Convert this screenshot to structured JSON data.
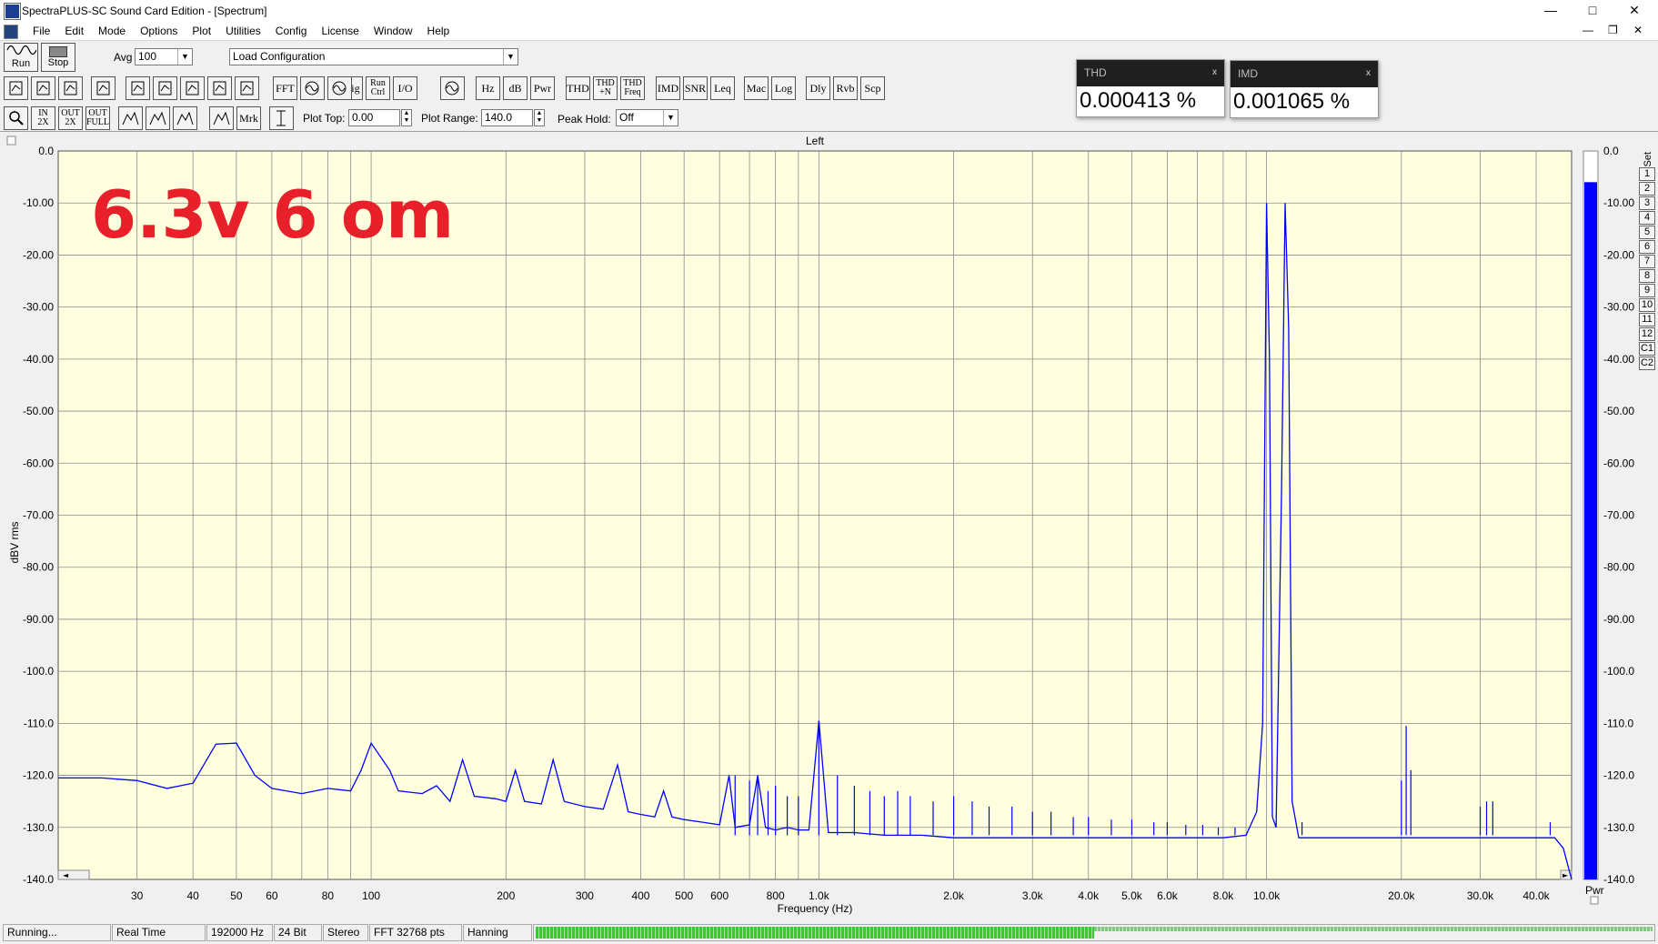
{
  "window": {
    "title": "SpectraPLUS-SC Sound Card Edition - [Spectrum]"
  },
  "menu": [
    "File",
    "Edit",
    "Mode",
    "Options",
    "Plot",
    "Utilities",
    "Config",
    "License",
    "Window",
    "Help"
  ],
  "toolbar": {
    "run_label": "Run",
    "stop_label": "Stop",
    "avg_label": "Avg",
    "avg_value": "100",
    "config_value": "Load Configuration",
    "buttons": [
      "FFT",
      "Trig",
      "Run Ctrl",
      "I/O",
      "Hz",
      "dB",
      "Pwr",
      "THD",
      "THD +N",
      "THD Freq",
      "IMD",
      "SNR",
      "Leq",
      "Mac",
      "Log",
      "Dly",
      "Rvb",
      "Scp"
    ],
    "zoom_buttons": [
      "IN 2X",
      "OUT 2X",
      "OUT FULL"
    ],
    "mrk_label": "Mrk",
    "plot_top_label": "Plot Top:",
    "plot_top_value": "0.00",
    "plot_range_label": "Plot Range:",
    "plot_range_value": "140.0",
    "peak_hold_label": "Peak Hold:",
    "peak_hold_value": "Off"
  },
  "meters": [
    {
      "title": "THD",
      "close": "x",
      "value": "0.000413 %"
    },
    {
      "title": "IMD",
      "close": "x",
      "value": "0.001065 %"
    }
  ],
  "annotation": "6.3v 6 om",
  "set_panel": {
    "label": "Set",
    "items": [
      "1",
      "2",
      "3",
      "4",
      "5",
      "6",
      "7",
      "8",
      "9",
      "10",
      "11",
      "12",
      "C1",
      "C2"
    ]
  },
  "colors": {
    "plot_background": "#ffffe0",
    "trace": "#0000ff",
    "grid": "#8a8a8a",
    "annotation": "#e8202a",
    "level_bar": "#0000ff",
    "status_meter": "#33cc33"
  },
  "chart_data": {
    "type": "line",
    "title": "Left",
    "xlabel": "Frequency (Hz)",
    "ylabel": "dBV rms",
    "x_scale": "log",
    "xlim": [
      20,
      48000
    ],
    "ylim": [
      -140,
      0
    ],
    "grid": true,
    "x_ticks": [
      {
        "v": 30,
        "label": "30"
      },
      {
        "v": 40,
        "label": "40"
      },
      {
        "v": 50,
        "label": "50"
      },
      {
        "v": 60,
        "label": "60"
      },
      {
        "v": 80,
        "label": "80"
      },
      {
        "v": 100,
        "label": "100"
      },
      {
        "v": 200,
        "label": "200"
      },
      {
        "v": 300,
        "label": "300"
      },
      {
        "v": 400,
        "label": "400"
      },
      {
        "v": 500,
        "label": "500"
      },
      {
        "v": 600,
        "label": "600"
      },
      {
        "v": 800,
        "label": "800"
      },
      {
        "v": 1000,
        "label": "1.0k"
      },
      {
        "v": 2000,
        "label": "2.0k"
      },
      {
        "v": 3000,
        "label": "3.0k"
      },
      {
        "v": 4000,
        "label": "4.0k"
      },
      {
        "v": 5000,
        "label": "5.0k"
      },
      {
        "v": 6000,
        "label": "6.0k"
      },
      {
        "v": 8000,
        "label": "8.0k"
      },
      {
        "v": 10000,
        "label": "10.0k"
      },
      {
        "v": 20000,
        "label": "20.0k"
      },
      {
        "v": 30000,
        "label": "30.0k"
      },
      {
        "v": 40000,
        "label": "40.0k"
      }
    ],
    "x_minor": [
      70,
      90,
      700,
      900,
      7000,
      9000
    ],
    "y_ticks": [
      {
        "v": 0,
        "label": "0.0"
      },
      {
        "v": -10,
        "label": "-10.00"
      },
      {
        "v": -20,
        "label": "-20.00"
      },
      {
        "v": -30,
        "label": "-30.00"
      },
      {
        "v": -40,
        "label": "-40.00"
      },
      {
        "v": -50,
        "label": "-50.00"
      },
      {
        "v": -60,
        "label": "-60.00"
      },
      {
        "v": -70,
        "label": "-70.00"
      },
      {
        "v": -80,
        "label": "-80.00"
      },
      {
        "v": -90,
        "label": "-90.00"
      },
      {
        "v": -100,
        "label": "-100.0"
      },
      {
        "v": -110,
        "label": "-110.0"
      },
      {
        "v": -120,
        "label": "-120.0"
      },
      {
        "v": -130,
        "label": "-130.0"
      },
      {
        "v": -140,
        "label": "-140.0"
      }
    ],
    "series": [
      {
        "points": [
          [
            20,
            -120.5
          ],
          [
            25,
            -120.5
          ],
          [
            30,
            -121
          ],
          [
            35,
            -122.5
          ],
          [
            40,
            -121.5
          ],
          [
            45,
            -114
          ],
          [
            50,
            -113.8
          ],
          [
            55,
            -120
          ],
          [
            60,
            -122.5
          ],
          [
            70,
            -123.5
          ],
          [
            80,
            -122.5
          ],
          [
            90,
            -123
          ],
          [
            95,
            -119
          ],
          [
            100,
            -113.8
          ],
          [
            110,
            -119
          ],
          [
            115,
            -123
          ],
          [
            130,
            -123.5
          ],
          [
            140,
            -122
          ],
          [
            150,
            -125
          ],
          [
            160,
            -117
          ],
          [
            170,
            -124
          ],
          [
            190,
            -124.5
          ],
          [
            200,
            -125
          ],
          [
            210,
            -119
          ],
          [
            220,
            -125
          ],
          [
            240,
            -125.5
          ],
          [
            255,
            -117
          ],
          [
            270,
            -125
          ],
          [
            300,
            -126
          ],
          [
            330,
            -126.5
          ],
          [
            355,
            -118
          ],
          [
            375,
            -127
          ],
          [
            400,
            -127.5
          ],
          [
            430,
            -128
          ],
          [
            450,
            -123
          ],
          [
            470,
            -128
          ],
          [
            500,
            -128.5
          ],
          [
            550,
            -129
          ],
          [
            600,
            -129.5
          ],
          [
            630,
            -120
          ],
          [
            650,
            -130
          ],
          [
            700,
            -129.5
          ],
          [
            730,
            -120
          ],
          [
            760,
            -130
          ],
          [
            800,
            -130.5
          ],
          [
            850,
            -130
          ],
          [
            900,
            -130.5
          ],
          [
            950,
            -130.5
          ],
          [
            1000,
            -109.5
          ],
          [
            1050,
            -131
          ],
          [
            1100,
            -131
          ],
          [
            1200,
            -131
          ],
          [
            1400,
            -131.5
          ],
          [
            1700,
            -131.5
          ],
          [
            2000,
            -132
          ],
          [
            2500,
            -132
          ],
          [
            3000,
            -132
          ],
          [
            4000,
            -132
          ],
          [
            5000,
            -132
          ],
          [
            6000,
            -132
          ],
          [
            7000,
            -132
          ],
          [
            8000,
            -132
          ],
          [
            9000,
            -131.5
          ],
          [
            9500,
            -127
          ],
          [
            9800,
            -110
          ],
          [
            10000,
            -10
          ],
          [
            10150,
            -40
          ],
          [
            10300,
            -128
          ],
          [
            10500,
            -130
          ],
          [
            10800,
            -65
          ],
          [
            11000,
            -10
          ],
          [
            11200,
            -34
          ],
          [
            11400,
            -125
          ],
          [
            11800,
            -132
          ],
          [
            13000,
            -132
          ],
          [
            16000,
            -132
          ],
          [
            19000,
            -132
          ],
          [
            20000,
            -132
          ],
          [
            21000,
            -132
          ],
          [
            25000,
            -132
          ],
          [
            30000,
            -132
          ],
          [
            35000,
            -132
          ],
          [
            40000,
            -132
          ],
          [
            44000,
            -132
          ],
          [
            46000,
            -134
          ],
          [
            48000,
            -140
          ]
        ]
      }
    ],
    "spurs": [
      [
        650,
        -120
      ],
      [
        700,
        -121
      ],
      [
        730,
        -120
      ],
      [
        770,
        -123
      ],
      [
        800,
        -122
      ],
      [
        850,
        -124
      ],
      [
        900,
        -124
      ],
      [
        1000,
        -109.5
      ],
      [
        1100,
        -120
      ],
      [
        1200,
        -122
      ],
      [
        1300,
        -123
      ],
      [
        1400,
        -124
      ],
      [
        1500,
        -123
      ],
      [
        1600,
        -124
      ],
      [
        1800,
        -125
      ],
      [
        2000,
        -124
      ],
      [
        2200,
        -125
      ],
      [
        2400,
        -126
      ],
      [
        2700,
        -126
      ],
      [
        3000,
        -127
      ],
      [
        3300,
        -127
      ],
      [
        3700,
        -128
      ],
      [
        4000,
        -128
      ],
      [
        4500,
        -128.5
      ],
      [
        5000,
        -128.5
      ],
      [
        5600,
        -129
      ],
      [
        6000,
        -129
      ],
      [
        6600,
        -129.5
      ],
      [
        7200,
        -129.5
      ],
      [
        7800,
        -130
      ],
      [
        8500,
        -130
      ],
      [
        12000,
        -129
      ],
      [
        20000,
        -121
      ],
      [
        20500,
        -110.5
      ],
      [
        21000,
        -119
      ],
      [
        30000,
        -126
      ],
      [
        31000,
        -125
      ],
      [
        32000,
        -125
      ],
      [
        43000,
        -129
      ]
    ]
  },
  "level_bar": {
    "label": "Pwr",
    "level_db": -6,
    "ticks": [
      "0.0",
      "-10.00",
      "-20.00",
      "-30.00",
      "-40.00",
      "-50.00",
      "-60.00",
      "-70.00",
      "-80.00",
      "-90.00",
      "-100.0",
      "-110.0",
      "-120.0",
      "-130.0",
      "-140.0"
    ]
  },
  "status": {
    "state": "Running...",
    "mode": "Real Time",
    "sample_rate": "192000 Hz",
    "bits": "24 Bit",
    "channels": "Stereo",
    "fft": "FFT 32768 pts",
    "window": "Hanning",
    "input_level": 0.5
  }
}
